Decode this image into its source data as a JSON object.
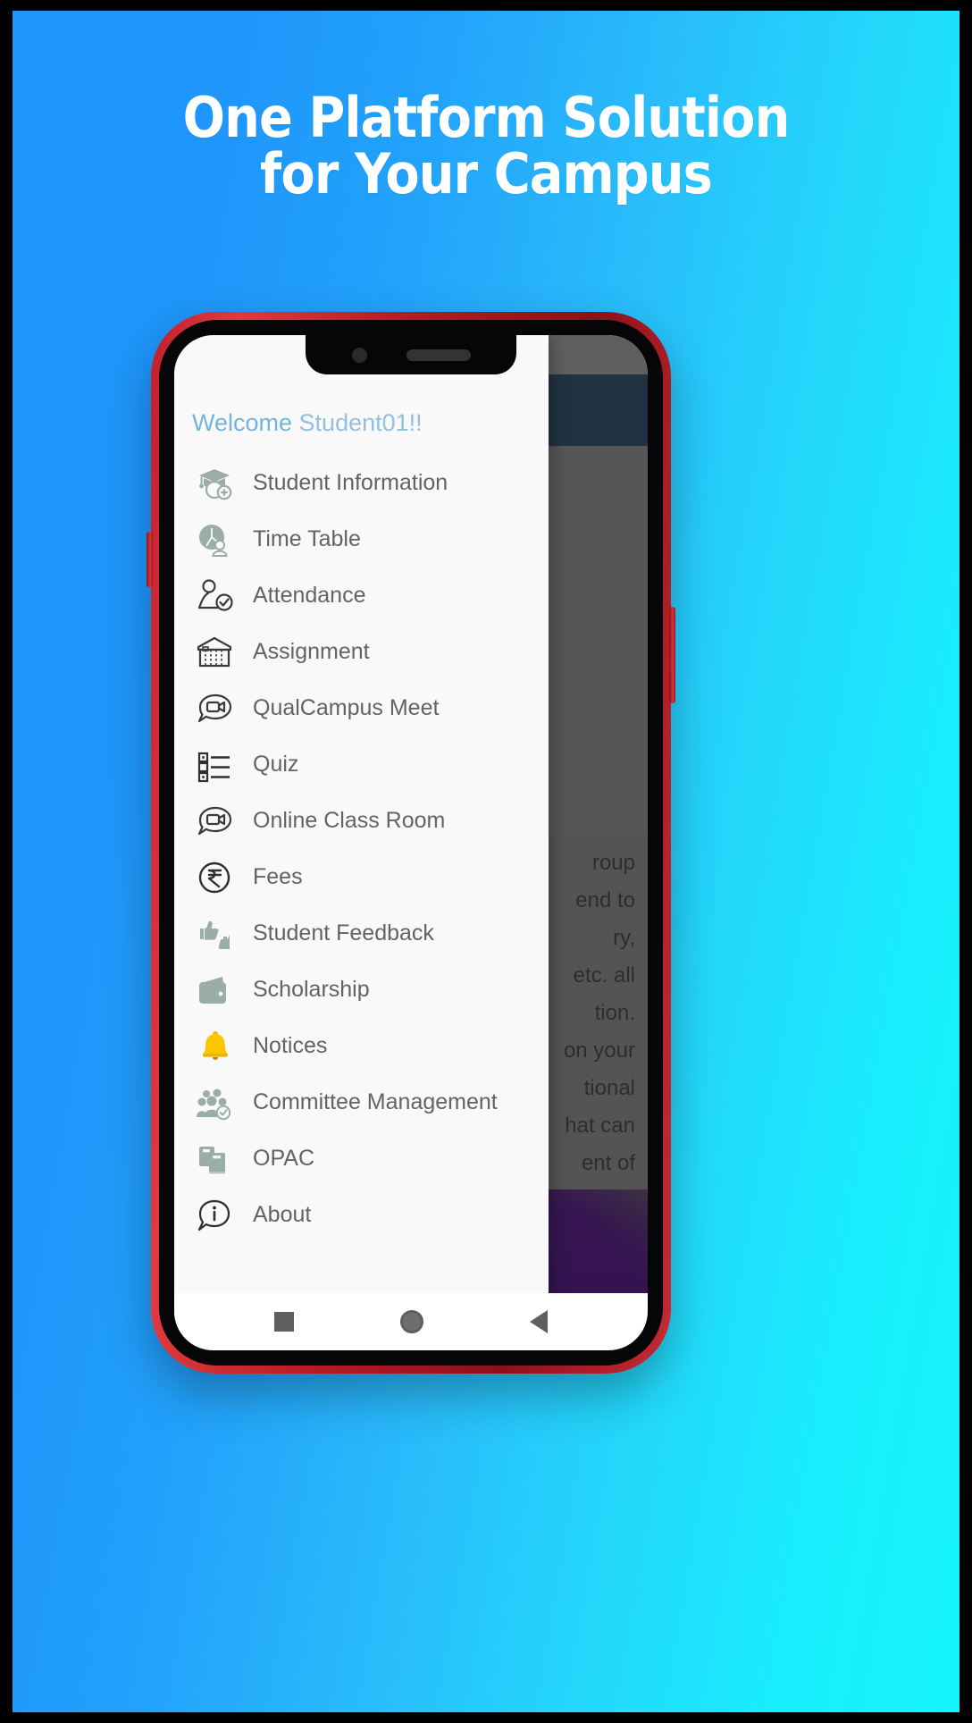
{
  "poster": {
    "headline_line1": "One Platform Solution",
    "headline_line2": "for Your Campus",
    "bg_color_left": "#1e96fb",
    "bg_color_right": "#14f4fd"
  },
  "phone": {
    "frame_color": "#c0202c",
    "bezel_color": "#060608"
  },
  "drawer": {
    "welcome_prefix": "Welcome ",
    "welcome_user": "Student01!!",
    "items": [
      {
        "label": "Student Information",
        "icon": "graduation-cap-add-icon"
      },
      {
        "label": "Time Table",
        "icon": "clock-person-icon"
      },
      {
        "label": "Attendance",
        "icon": "person-check-icon"
      },
      {
        "label": "Assignment",
        "icon": "building-icon"
      },
      {
        "label": "QualCampus Meet",
        "icon": "video-chat-bubble-icon"
      },
      {
        "label": "Quiz",
        "icon": "checklist-icon"
      },
      {
        "label": "Online Class Room",
        "icon": "video-chat-bubble-icon"
      },
      {
        "label": "Fees",
        "icon": "rupee-circle-icon"
      },
      {
        "label": "Student Feedback",
        "icon": "thumbs-up-down-icon"
      },
      {
        "label": "Scholarship",
        "icon": "wallet-icon"
      },
      {
        "label": "Notices",
        "icon": "bell-icon"
      },
      {
        "label": "Committee Management",
        "icon": "group-check-icon"
      },
      {
        "label": "OPAC",
        "icon": "books-icon"
      },
      {
        "label": "About",
        "icon": "info-bubble-icon"
      }
    ]
  },
  "app_background": {
    "appbar_color": "#38566e",
    "paragraph_visible_text": "roup\nend to\nry,\netc. all\ntion.\non your\ntional\nhat can\nent of\nation"
  },
  "android_nav": {
    "recents": "recents-square-icon",
    "home": "home-circle-icon",
    "back": "back-triangle-icon"
  }
}
